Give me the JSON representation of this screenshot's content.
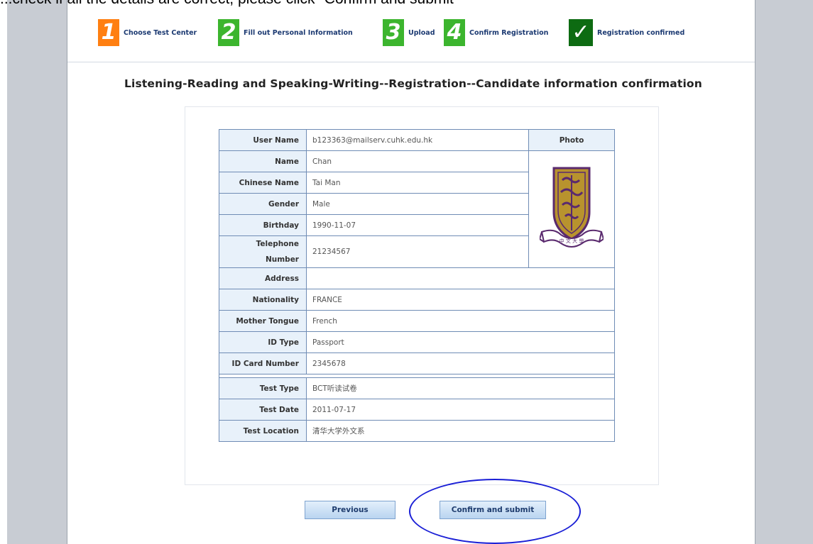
{
  "caption": "...check if all the details are correct, please click \"Confirm and submit\"",
  "steps": [
    {
      "num": "1",
      "label": "Choose Test Center"
    },
    {
      "num": "2",
      "label": "Fill out Personal Information"
    },
    {
      "num": "3",
      "label": "Upload"
    },
    {
      "num": "4",
      "label": "Confirm Registration"
    },
    {
      "num": "✓",
      "label": "Registration confirmed"
    }
  ],
  "title": "Listening-Reading and Speaking-Writing--Registration--Candidate information confirmation",
  "table": {
    "photo_label": "Photo",
    "rows": [
      {
        "label": "User Name",
        "value": "b123363@mailserv.cuhk.edu.hk"
      },
      {
        "label": "Name",
        "value": "Chan"
      },
      {
        "label": "Chinese Name",
        "value": "Tai Man"
      },
      {
        "label": "Gender",
        "value": "Male"
      },
      {
        "label": "Birthday",
        "value": "1990-11-07"
      },
      {
        "label": "Telephone Number",
        "value": "21234567"
      },
      {
        "label": "Address",
        "value": ""
      },
      {
        "label": "Nationality",
        "value": "FRANCE"
      },
      {
        "label": "Mother Tongue",
        "value": "French"
      },
      {
        "label": "ID Type",
        "value": "Passport"
      },
      {
        "label": "ID Card Number",
        "value": "2345678"
      },
      {
        "label": "Test Type",
        "value": "BCT听读试卷"
      },
      {
        "label": "Test Date",
        "value": "2011-07-17"
      },
      {
        "label": "Test Location",
        "value": "清华大学外文系"
      }
    ]
  },
  "buttons": {
    "previous": "Previous",
    "confirm": "Confirm and submit"
  },
  "colors": {
    "step_orange": "#ff7f11",
    "step_green": "#3cb52e",
    "step_done": "#0d6b12",
    "annotation": "#1a1fd6"
  }
}
